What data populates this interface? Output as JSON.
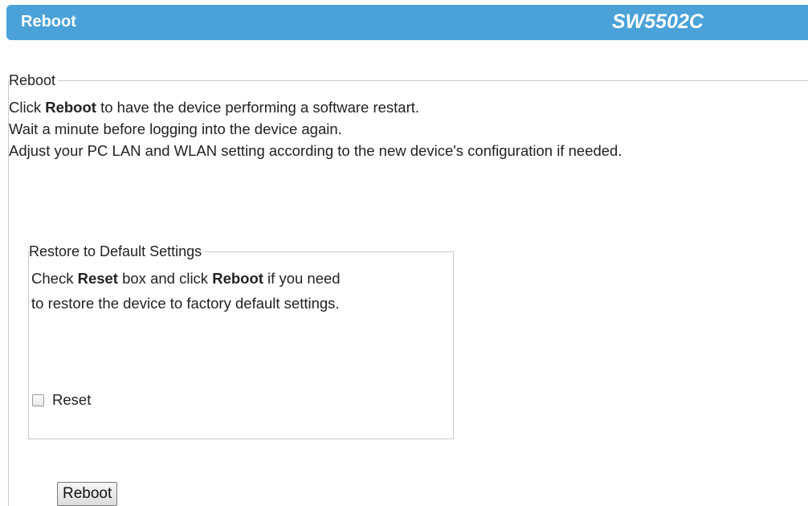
{
  "header": {
    "title": "Reboot",
    "model": "SW5502C"
  },
  "reboot_section": {
    "legend": "Reboot",
    "line1_prefix": "Click ",
    "line1_bold": "Reboot",
    "line1_suffix": " to have the device performing a software restart.",
    "line2": "Wait a minute before logging into the device again.",
    "line3": "Adjust your PC LAN and WLAN setting according to the new device's configuration if needed."
  },
  "restore_section": {
    "legend": "Restore to Default Settings",
    "line1_prefix": "Check ",
    "line1_bold1": "Reset",
    "line1_mid": " box and click ",
    "line1_bold2": "Reboot",
    "line1_suffix": " if you need",
    "line2": "to restore the device to factory default settings.",
    "reset_label": "Reset",
    "reset_checked": false
  },
  "reboot_button": {
    "label": "Reboot"
  },
  "colors": {
    "header_bg": "#4aa2d9",
    "header_text": "#ffffff",
    "border": "#c9c9c9"
  }
}
